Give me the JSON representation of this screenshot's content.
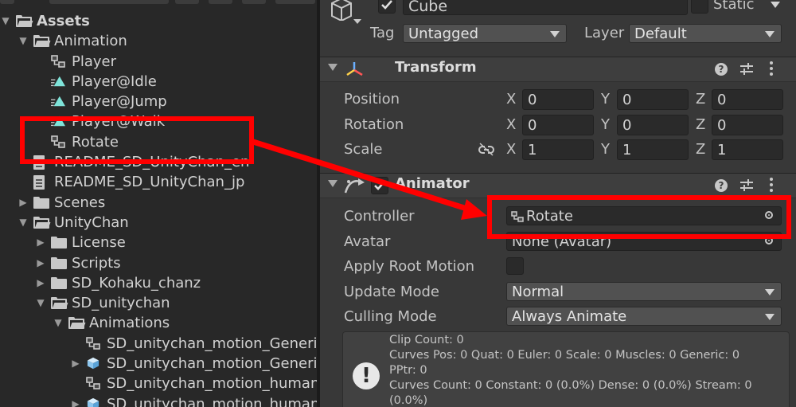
{
  "project": {
    "root": "Assets",
    "rows": [
      {
        "label": "Assets",
        "icon": "folder-open",
        "depth": 0,
        "arrow": "down"
      },
      {
        "label": "Animation",
        "icon": "folder-open",
        "depth": 1,
        "arrow": "down"
      },
      {
        "label": "Player",
        "icon": "animator-controller",
        "depth": 2,
        "arrow": ""
      },
      {
        "label": "Player@Idle",
        "icon": "animation-clip",
        "depth": 2,
        "arrow": ""
      },
      {
        "label": "Player@Jump",
        "icon": "animation-clip",
        "depth": 2,
        "arrow": ""
      },
      {
        "label": "Player@Walk",
        "icon": "animation-clip",
        "depth": 2,
        "arrow": ""
      },
      {
        "label": "Rotate",
        "icon": "animator-controller",
        "depth": 2,
        "arrow": ""
      },
      {
        "label": "README_SD_UnityChan_en",
        "icon": "document",
        "depth": 1,
        "arrow": ""
      },
      {
        "label": "README_SD_UnityChan_jp",
        "icon": "document",
        "depth": 1,
        "arrow": ""
      },
      {
        "label": "Scenes",
        "icon": "folder",
        "depth": 1,
        "arrow": "right"
      },
      {
        "label": "UnityChan",
        "icon": "folder-open",
        "depth": 1,
        "arrow": "down"
      },
      {
        "label": "License",
        "icon": "folder",
        "depth": 2,
        "arrow": "right"
      },
      {
        "label": "Scripts",
        "icon": "folder",
        "depth": 2,
        "arrow": "right"
      },
      {
        "label": "SD_Kohaku_chanz",
        "icon": "folder",
        "depth": 2,
        "arrow": "right"
      },
      {
        "label": "SD_unitychan",
        "icon": "folder-open",
        "depth": 2,
        "arrow": "down"
      },
      {
        "label": "Animations",
        "icon": "folder-open",
        "depth": 3,
        "arrow": "down"
      },
      {
        "label": "SD_unitychan_motion_Generic",
        "icon": "animator-controller",
        "depth": 4,
        "arrow": ""
      },
      {
        "label": "SD_unitychan_motion_Generic",
        "icon": "model-cube",
        "depth": 4,
        "arrow": "right"
      },
      {
        "label": "SD_unitychan_motion_humanoid",
        "icon": "animator-controller",
        "depth": 4,
        "arrow": ""
      },
      {
        "label": "SD_unitychan_motion_humanoid",
        "icon": "model-cube",
        "depth": 4,
        "arrow": "right"
      }
    ]
  },
  "inspector": {
    "object": {
      "name": "Cube",
      "active": true,
      "static_label": "Static",
      "tag_label": "Tag",
      "tag_value": "Untagged",
      "layer_label": "Layer",
      "layer_value": "Default"
    },
    "transform": {
      "title": "Transform",
      "rows": [
        {
          "label": "Position",
          "x": "0",
          "y": "0",
          "z": "0"
        },
        {
          "label": "Rotation",
          "x": "0",
          "y": "0",
          "z": "0"
        },
        {
          "label": "Scale",
          "x": "1",
          "y": "1",
          "z": "1"
        }
      ],
      "axis_x": "X",
      "axis_y": "Y",
      "axis_z": "Z"
    },
    "animator": {
      "title": "Animator",
      "controller_label": "Controller",
      "controller_value": "Rotate",
      "avatar_label": "Avatar",
      "avatar_value": "None (Avatar)",
      "apply_root_motion_label": "Apply Root Motion",
      "update_mode_label": "Update Mode",
      "update_mode_value": "Normal",
      "culling_mode_label": "Culling Mode",
      "culling_mode_value": "Always Animate"
    },
    "info": {
      "lines": [
        "Clip Count: 0",
        "Curves Pos: 0 Quat: 0 Euler: 0 Scale: 0 Muscles: 0 Generic: 0",
        "PPtr: 0",
        "Curves Count: 0 Constant: 0 (0.0%) Dense: 0 (0.0%) Stream: 0",
        "(0.0%)"
      ]
    }
  },
  "colors": {
    "highlight": "#ff0000",
    "panel": "#383838",
    "tree_bg": "#282828"
  }
}
